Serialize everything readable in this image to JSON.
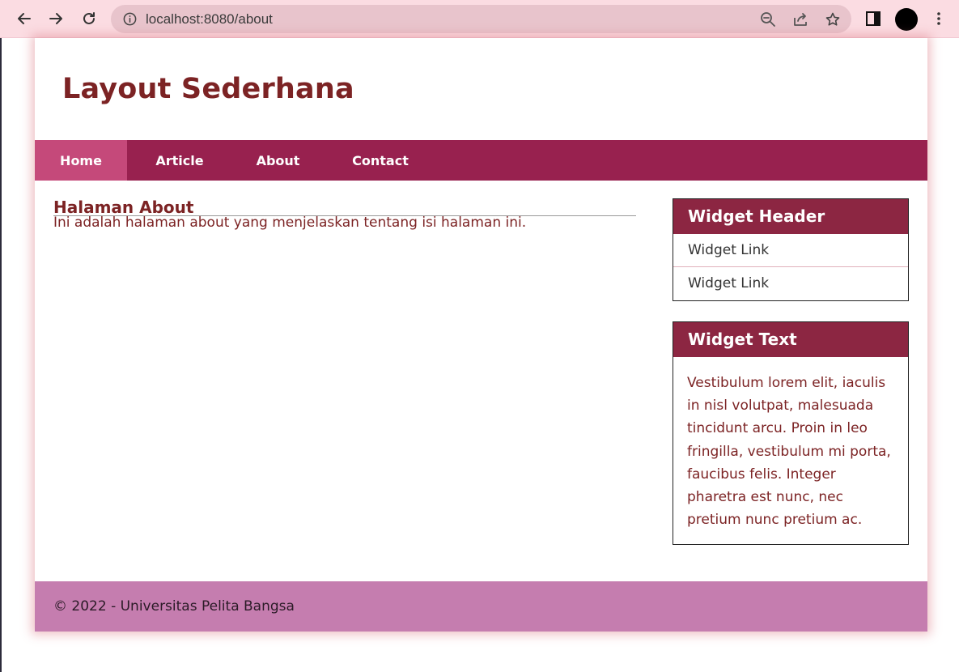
{
  "browser": {
    "url": "localhost:8080/about",
    "icons": [
      "back-icon",
      "forward-icon",
      "reload-icon",
      "info-icon",
      "zoom-out-icon",
      "share-icon",
      "star-icon",
      "sidebar-icon",
      "profile-avatar",
      "menu-dots-icon"
    ]
  },
  "site": {
    "title": "Layout Sederhana"
  },
  "nav": {
    "items": [
      "Home",
      "Article",
      "About",
      "Contact"
    ],
    "active": "Home"
  },
  "main": {
    "heading": "Halaman About",
    "body": "Ini adalah halaman about yang menjelaskan tentang isi halaman ini."
  },
  "sidebar": {
    "widget1": {
      "header": "Widget Header",
      "links": [
        "Widget Link",
        "Widget Link"
      ]
    },
    "widget2": {
      "header": "Widget Text",
      "text": "Vestibulum lorem elit, iaculis in nisl volutpat, malesuada tincidunt arcu. Proin in leo fringilla, vestibulum mi porta, faucibus felis. Integer pharetra est nunc, nec pretium nunc pretium ac."
    }
  },
  "footer": {
    "text": "© 2022 - Universitas Pelita Bangsa"
  },
  "colors": {
    "title": "#7c2324",
    "nav": "#98214f",
    "nav_active": "#c5497a",
    "widget_header": "#8c2642",
    "footer": "#c57daf",
    "browser_bar": "#fbdce2"
  }
}
